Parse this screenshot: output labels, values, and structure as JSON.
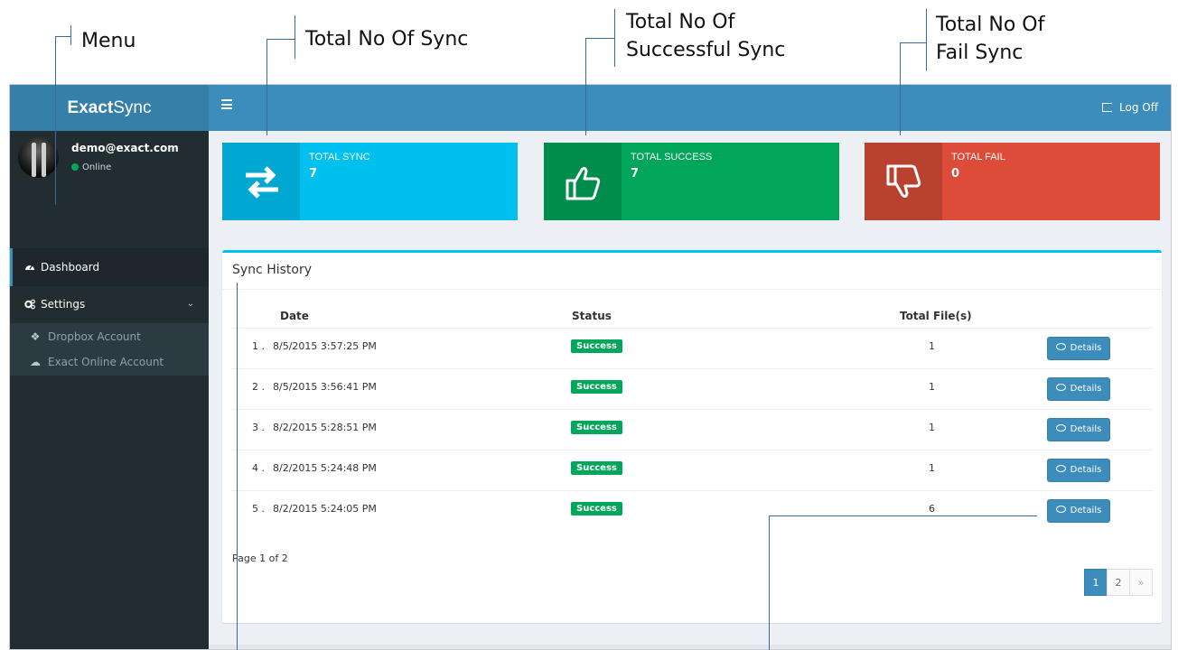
{
  "annotations": {
    "menu": "Menu",
    "total_sync": "Total No Of Sync",
    "total_success_line1": "Total No Of",
    "total_success_line2": "Successful Sync",
    "total_fail_line1": "Total No Of",
    "total_fail_line2": "Fail Sync"
  },
  "header": {
    "brand_bold": "Exact",
    "brand_rest": "Sync",
    "logoff_label": "Log Off",
    "colors": {
      "topbar": "#3c8dbc",
      "brand_bg": "#367fa9"
    }
  },
  "sidebar": {
    "user_email": "demo@exact.com",
    "user_status": "Online",
    "items": [
      {
        "label": "Dashboard",
        "icon": "dashboard-icon",
        "active": true
      },
      {
        "label": "Settings",
        "icon": "cogs-icon",
        "expanded": true
      }
    ],
    "subitems": [
      {
        "label": "Dropbox Account",
        "icon": "dropbox-icon"
      },
      {
        "label": "Exact Online Account",
        "icon": "cloud-icon"
      }
    ]
  },
  "stats": {
    "total_sync": {
      "label": "TOTAL SYNC",
      "value": "7",
      "icon": "exchange-icon",
      "color": "#00c0ef"
    },
    "total_success": {
      "label": "TOTAL SUCCESS",
      "value": "7",
      "icon": "thumbs-up-icon",
      "color": "#00a65a"
    },
    "total_fail": {
      "label": "TOTAL FAIL",
      "value": "0",
      "icon": "thumbs-down-icon",
      "color": "#dd4b39"
    }
  },
  "history": {
    "title": "Sync History",
    "columns": {
      "date": "Date",
      "status": "Status",
      "files": "Total File(s)"
    },
    "details_label": "Details",
    "rows": [
      {
        "index": "1 .",
        "date": "8/5/2015 3:57:25 PM",
        "status": "Success",
        "files": "1"
      },
      {
        "index": "2 .",
        "date": "8/5/2015 3:56:41 PM",
        "status": "Success",
        "files": "1"
      },
      {
        "index": "3 .",
        "date": "8/2/2015 5:28:51 PM",
        "status": "Success",
        "files": "1"
      },
      {
        "index": "4 .",
        "date": "8/2/2015 5:24:48 PM",
        "status": "Success",
        "files": "1"
      },
      {
        "index": "5 .",
        "date": "8/2/2015 5:24:05 PM",
        "status": "Success",
        "files": "6"
      }
    ],
    "page_info": "Page 1 of 2",
    "pager": {
      "page1": "1",
      "page2": "2",
      "next": "»"
    }
  }
}
